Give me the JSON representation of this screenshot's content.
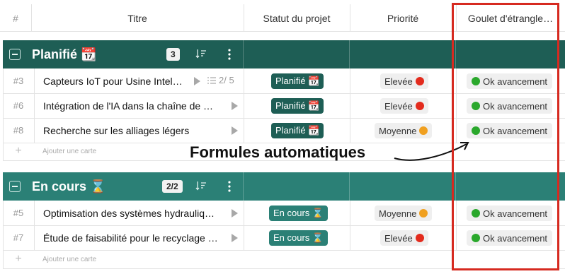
{
  "header": {
    "hash": "#",
    "titre": "Titre",
    "statut": "Statut du projet",
    "priorite": "Priorité",
    "goulet": "Goulet d'étrangle…"
  },
  "groups": [
    {
      "title": "Planifié 📆",
      "count": "3",
      "add_label": "Ajouter une carte",
      "rows": [
        {
          "num": "#3",
          "title": "Capteurs IoT pour Usine Intel…",
          "checklist": "2/ 5",
          "status": "Planifié 📆",
          "priority": "Elevée",
          "priority_color": "#e32b1d",
          "bottleneck": "Ok avancement",
          "bottleneck_color": "#2aa82c"
        },
        {
          "num": "#6",
          "title": "Intégration de l'IA dans la chaîne de …",
          "status": "Planifié 📆",
          "priority": "Elevée",
          "priority_color": "#e32b1d",
          "bottleneck": "Ok avancement",
          "bottleneck_color": "#2aa82c"
        },
        {
          "num": "#8",
          "title": "Recherche sur les alliages légers",
          "status": "Planifié 📆",
          "priority": "Moyenne",
          "priority_color": "#f0a020",
          "bottleneck": "Ok avancement",
          "bottleneck_color": "#2aa82c"
        }
      ]
    },
    {
      "title": "En cours ⌛",
      "count": "2/2",
      "add_label": "Ajouter une carte",
      "rows": [
        {
          "num": "#5",
          "title": "Optimisation des systèmes hydrauliq…",
          "status": "En cours ⌛",
          "priority": "Moyenne",
          "priority_color": "#f0a020",
          "bottleneck": "Ok avancement",
          "bottleneck_color": "#2aa82c"
        },
        {
          "num": "#7",
          "title": "Étude de faisabilité pour le recyclage …",
          "status": "En cours ⌛",
          "priority": "Elevée",
          "priority_color": "#e32b1d",
          "bottleneck": "Ok avancement",
          "bottleneck_color": "#2aa82c"
        }
      ]
    }
  ],
  "annotation": "Formules automatiques",
  "colors": {
    "group1": "#1e5e55",
    "group2": "#2b8076",
    "highlight_frame": "#d62a20"
  }
}
